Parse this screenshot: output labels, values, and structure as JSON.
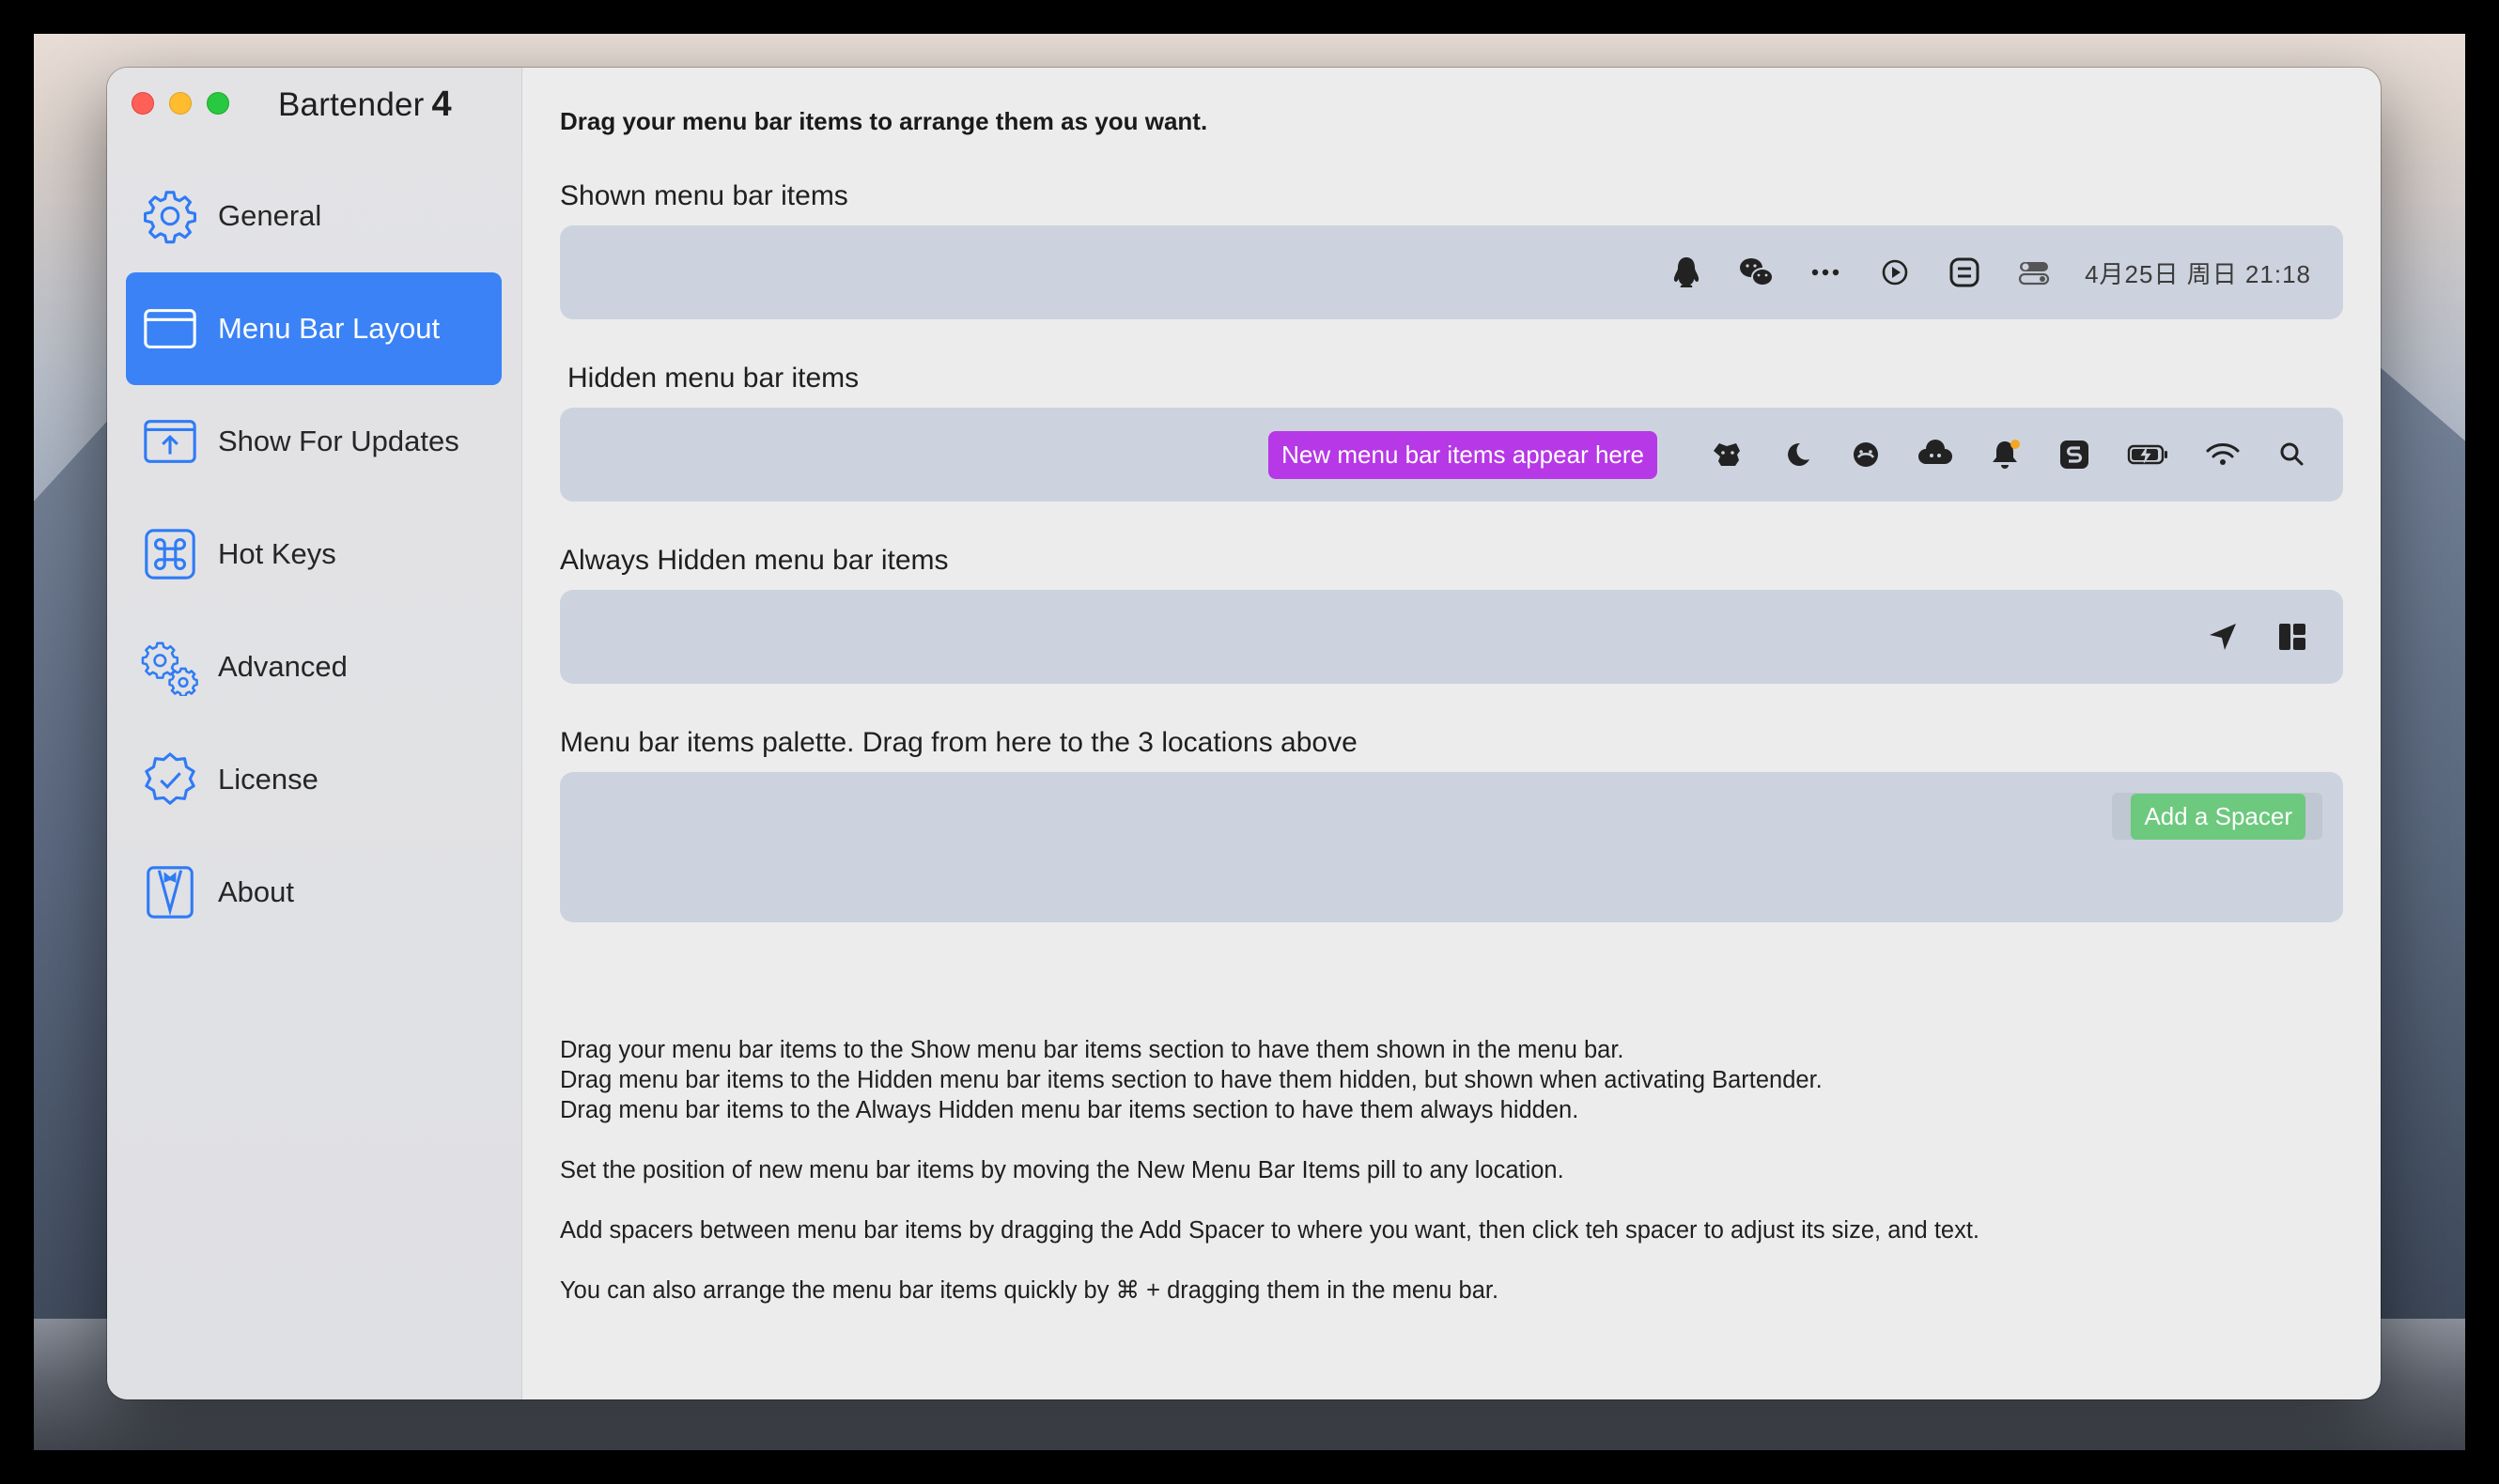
{
  "app": {
    "name": "Bartender",
    "version": "4"
  },
  "sidebar": {
    "items": [
      {
        "label": "General",
        "icon": "gear-icon",
        "active": false
      },
      {
        "label": "Menu Bar Layout",
        "icon": "menubar-layout-icon",
        "active": true
      },
      {
        "label": "Show For Updates",
        "icon": "upload-icon",
        "active": false
      },
      {
        "label": "Hot Keys",
        "icon": "command-key-icon",
        "active": false
      },
      {
        "label": "Advanced",
        "icon": "gears-icon",
        "active": false
      },
      {
        "label": "License",
        "icon": "verified-badge-icon",
        "active": false
      },
      {
        "label": "About",
        "icon": "bartender-logo-icon",
        "active": false
      }
    ]
  },
  "main": {
    "heading": "Drag your menu bar items to arrange them as you want.",
    "shown": {
      "label": "Shown menu bar items",
      "clock": "4月25日 周日  21:18",
      "icons": [
        "qq-penguin-icon",
        "wechat-icon",
        "more-dots-icon",
        "play-circle-icon",
        "app-s-icon",
        "toggle-icon"
      ]
    },
    "hidden": {
      "label": "Hidden menu bar items",
      "new_items_pill": "New menu bar items appear here",
      "icons": [
        "dog-icon",
        "moon-icon",
        "face-icon",
        "cloud-face-icon",
        "notification-bell-icon",
        "s-app-icon",
        "battery-charging-icon",
        "wifi-icon",
        "search-icon"
      ]
    },
    "always_hidden": {
      "label": "Always Hidden menu bar items",
      "icons": [
        "location-arrow-icon",
        "layout-grid-icon"
      ]
    },
    "palette": {
      "label": "Menu bar items palette. Drag from here to the 3 locations above",
      "add_spacer": "Add a Spacer"
    },
    "help": [
      "Drag your menu bar items to the Show menu bar items section to have them shown in the menu bar.",
      "Drag menu bar items to the Hidden menu bar items section to have them hidden, but shown when activating Bartender.",
      "Drag menu bar items to the Always Hidden menu bar items section to have them always hidden.",
      "Set the position of new menu bar items by moving the New Menu Bar Items pill to any location.",
      "Add spacers between menu bar items by dragging the Add Spacer to where you want, then click teh spacer to adjust its size, and text.",
      "You can also arrange the menu bar items quickly by ⌘ + dragging them in the menu bar."
    ]
  },
  "colors": {
    "accent": "#3a82f6",
    "new_pill": "#b638e6",
    "spacer": "#6cc97d",
    "tray": "#ccd3de"
  }
}
